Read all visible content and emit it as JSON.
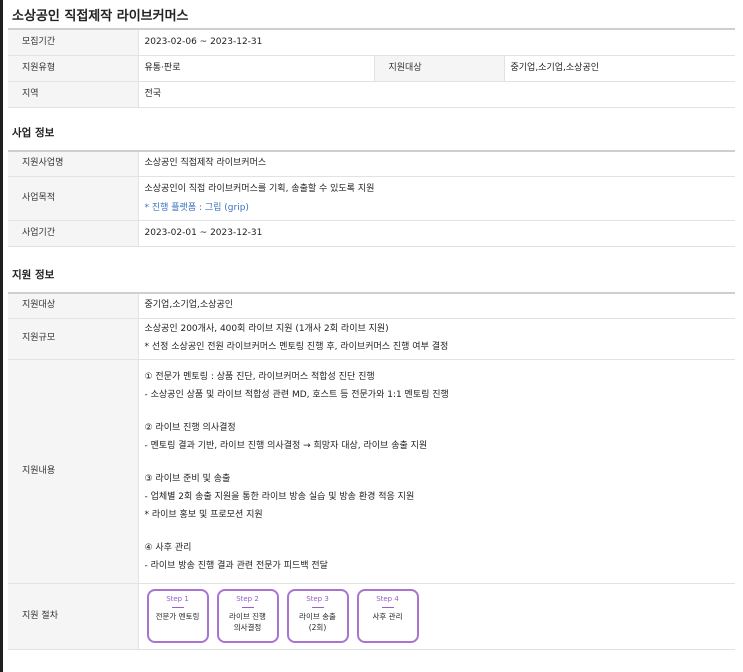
{
  "page_title": "소상공인 직접제작 라이브커머스",
  "summary": {
    "recruit_period_label": "모집기간",
    "recruit_period_value": "2023-02-06 ~ 2023-12-31",
    "support_type_label": "지원유형",
    "support_type_value": "유통·판로",
    "support_target_label": "지원대상",
    "support_target_value": "중기업,소기업,소상공인",
    "region_label": "지역",
    "region_value": "전국"
  },
  "business": {
    "title": "사업 정보",
    "name_label": "지원사업명",
    "name_value": "소상공인 직접제작 라이브커머스",
    "purpose_label": "사업목적",
    "purpose_line1": "소상공인이 직접 라이브커머스를 기획, 송출할 수 있도록 지원",
    "purpose_line2": "* 진행 플랫폼 : 그립 (grip)",
    "period_label": "사업기간",
    "period_value": "2023-02-01 ~ 2023-12-31"
  },
  "support": {
    "title": "지원 정보",
    "target_label": "지원대상",
    "target_value": "중기업,소기업,소상공인",
    "scale_label": "지원규모",
    "scale_line1": "소상공인 200개사, 400회 라이브 지원 (1개사 2회 라이브 지원)",
    "scale_line2": "* 선정 소상공인 전원 라이브커머스 멘토링 진행 후, 라이브커머스 진행 여부 결정",
    "content_label": "지원내용",
    "content_s1_title": "① 전문가 멘토링 : 상품 진단, 라이브커머스 적합성 진단 진행",
    "content_s1_line": "- 소상공인 상품 및 라이브 적합성 관련 MD, 호스트 등 전문가와 1:1 멘토링 진행",
    "content_s2_title": "② 라이브 진행 의사결정",
    "content_s2_line": "- 멘토링 결과 기반, 라이브 진행 의사결정 → 희망자 대상, 라이브 송출 지원",
    "content_s3_title": "③ 라이브 준비 및 송출",
    "content_s3_line1": "- 업체별 2회 송출 지원을 통한 라이브 방송 실습 및 방송 환경 적응 지원",
    "content_s3_line2": "* 라이브 홍보 및 프로모션 지원",
    "content_s4_title": "④ 사후 관리",
    "content_s4_line": "- 라이브 방송 진행 결과 관련 전문가 피드백 전달",
    "procedure_label": "지원 절차",
    "steps": [
      {
        "label": "Step 1",
        "text": "전문가 멘토링"
      },
      {
        "label": "Step 2",
        "text": "라이브 진행\n의사결정"
      },
      {
        "label": "Step 3",
        "text": "라이브 송출\n(2회)"
      },
      {
        "label": "Step 4",
        "text": "사후 관리"
      }
    ]
  },
  "colors": {
    "accent_purple": "#a874d0",
    "note_blue": "#3a73c5",
    "header_cell_bg": "#f5f5f5"
  }
}
